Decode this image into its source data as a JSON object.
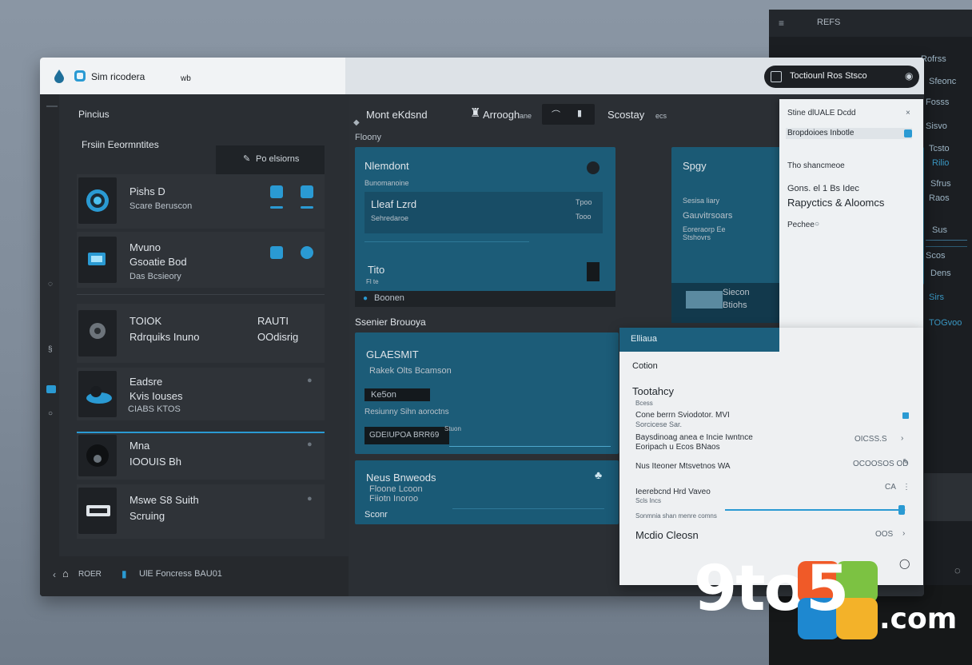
{
  "titlebar": {
    "title": "Sim ricodera",
    "extra": "wb"
  },
  "search": {
    "label": "Toctiounl Ros Stsco"
  },
  "back_window": {
    "header": "REFS",
    "labels": [
      "Rofrss",
      "Sfeonc",
      "Fosss",
      "Sisvo",
      "Tcsto",
      "Rilio",
      "Sfrus",
      "Raos",
      "Sus",
      "Scos",
      "Dens",
      "Sirs",
      "TOGvoo"
    ]
  },
  "sidebar": {
    "section_title": "Pincius",
    "subtitle": "Frsiin Eeormntites",
    "button_label": "Po elsiorns",
    "items": [
      {
        "title": "Pishs D",
        "subtitle": "Scare Beruscon",
        "meta": ""
      },
      {
        "title": "Mvuno",
        "subtitle": "Gsoatie Bod",
        "meta": "Das Bcsieory"
      },
      {
        "title": "TOIOK",
        "subtitle": "Rdrquiks Inuno",
        "meta": "",
        "right1": "RAUTI",
        "right2": "OOdisrig"
      },
      {
        "title": "Eadsre",
        "subtitle": "Kvis Iouses",
        "meta": "CIABS KTOS"
      },
      {
        "title": "Mna",
        "subtitle": "IOOUIS Bh",
        "meta": ""
      },
      {
        "title": "Mswe S8 Suith",
        "subtitle": "Scruing",
        "meta": ""
      }
    ],
    "footer_left": "ROER",
    "footer_mid": "UlE Foncress BAU01"
  },
  "toolbar": {
    "left": "Mont eKdsnd",
    "mid": "Arroogh",
    "mid_suffix": "ane",
    "right": "Scostay",
    "right_suffix": "ecs"
  },
  "content": {
    "section1": "Floony",
    "panel1": {
      "title": "Nlemdont",
      "sub": "Bunomanoine",
      "row_title": "Lleaf Lzrd",
      "row_sub": "Sehredaroe",
      "val1": "Tpoo",
      "val2": "Tooo",
      "footer": "Tito",
      "footer_sub": "Fl te",
      "bottom": "Boonen"
    },
    "panel2": {
      "title": "Spgy",
      "line1": "Sesisa liary",
      "line2": "Gauvitrsoars",
      "line3": "Eoreraorp Ee",
      "line4": "Stshovrs",
      "line5": "Siecon",
      "line6": "Btiohs"
    },
    "section2": "Ssenier Brouoya",
    "panel3": {
      "title": "GLAESMIT",
      "sub": "Rakek Olts Bcamson",
      "chip": "Ke5on",
      "line": "Resiunny Sihn aoroctns",
      "bar": "GDEIUPOA BRR69",
      "bar_label": "Stuon"
    },
    "panel4": {
      "title": "Neus Bnweods",
      "sub": "Floone Lcoon",
      "sub2": "Fiiotn Inoroo",
      "footer": "Sconr"
    }
  },
  "right_panel": {
    "line1": "Stine dlUALE Dcdd",
    "highlight": "Bropdoioes Inbotle",
    "line2": "Tho shancmeoe",
    "line3": "Gons. el 1 Bs Idec",
    "big": "Rapyctics & Aloomcs",
    "line4": "Pechee"
  },
  "bottom_panel": {
    "header": "Elliaua",
    "option": "Cotion",
    "section": "Tootahcy",
    "section_sub": "Bcess",
    "rows": [
      {
        "label": "Cone berrn Sviodotor. MVI",
        "sub": "Sorcicese Sar.",
        "value": ""
      },
      {
        "label": "Baysdinoag anea e Incie Iwntnce",
        "sub": "Eoripach u Ecos BNaos",
        "value": "OICSS.S"
      },
      {
        "label": "Nus Iteoner Mtsvetnos WA",
        "sub": "",
        "value": "OCOOSOS OD"
      },
      {
        "label": "Ieerebcnd Hrd Vaveo",
        "sub": "Scls Incs",
        "value": "CA"
      },
      {
        "label": "",
        "sub": "Sonmnia shan menre comns",
        "value": ""
      }
    ],
    "footer": "Mcdio Cleosn",
    "footer_value": "OOS"
  },
  "slider_levels": {
    "row1": 0.98,
    "row4": 0.92
  },
  "logo": {
    "text_a": "9to",
    "text_b": "5",
    "suffix": ".com"
  },
  "colors": {
    "accent": "#2a9ad3",
    "panel": "#1c5c78",
    "window": "#2d3136"
  }
}
